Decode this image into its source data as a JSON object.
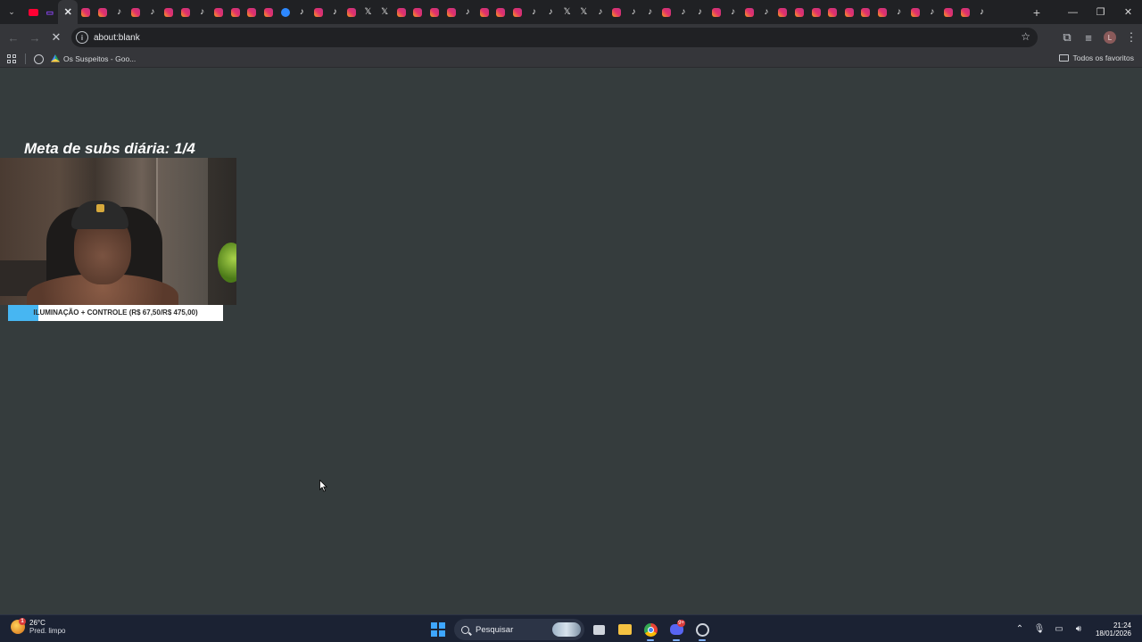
{
  "browser": {
    "tabs": [
      {
        "icon": "youtube-icon",
        "kind": "youtube",
        "glyph": ""
      },
      {
        "icon": "twitch-icon",
        "kind": "twitch",
        "glyph": "▭"
      },
      {
        "icon": "close-tab-icon",
        "kind": "close",
        "glyph": "✕",
        "active": true
      },
      {
        "icon": "instagram-icon",
        "kind": "instagram",
        "glyph": ""
      },
      {
        "icon": "instagram-icon",
        "kind": "instagram",
        "glyph": ""
      },
      {
        "icon": "tiktok-icon",
        "kind": "tiktok",
        "glyph": "♪"
      },
      {
        "icon": "instagram-icon",
        "kind": "instagram",
        "glyph": ""
      },
      {
        "icon": "tiktok-icon",
        "kind": "tiktok",
        "glyph": "♪"
      },
      {
        "icon": "instagram-icon",
        "kind": "instagram",
        "glyph": ""
      },
      {
        "icon": "instagram-icon",
        "kind": "instagram",
        "glyph": ""
      },
      {
        "icon": "tiktok-icon",
        "kind": "tiktok",
        "glyph": "♪"
      },
      {
        "icon": "instagram-icon",
        "kind": "instagram",
        "glyph": ""
      },
      {
        "icon": "instagram-icon",
        "kind": "instagram",
        "glyph": ""
      },
      {
        "icon": "instagram-icon",
        "kind": "instagram",
        "glyph": ""
      },
      {
        "icon": "instagram-icon",
        "kind": "instagram",
        "glyph": ""
      },
      {
        "icon": "messenger-icon",
        "kind": "messenger",
        "glyph": ""
      },
      {
        "icon": "tiktok-icon",
        "kind": "tiktok",
        "glyph": "♪"
      },
      {
        "icon": "instagram-icon",
        "kind": "instagram",
        "glyph": ""
      },
      {
        "icon": "tiktok-icon",
        "kind": "tiktok",
        "glyph": "♪"
      },
      {
        "icon": "instagram-icon",
        "kind": "instagram",
        "glyph": ""
      },
      {
        "icon": "x-icon",
        "kind": "x",
        "glyph": "𝕏"
      },
      {
        "icon": "x-icon",
        "kind": "x",
        "glyph": "𝕏"
      },
      {
        "icon": "instagram-icon",
        "kind": "instagram",
        "glyph": ""
      },
      {
        "icon": "instagram-icon",
        "kind": "instagram",
        "glyph": ""
      },
      {
        "icon": "instagram-icon",
        "kind": "instagram",
        "glyph": ""
      },
      {
        "icon": "instagram-icon",
        "kind": "instagram",
        "glyph": ""
      },
      {
        "icon": "tiktok-icon",
        "kind": "tiktok",
        "glyph": "♪"
      },
      {
        "icon": "instagram-icon",
        "kind": "instagram",
        "glyph": ""
      },
      {
        "icon": "instagram-icon",
        "kind": "instagram",
        "glyph": ""
      },
      {
        "icon": "instagram-icon",
        "kind": "instagram",
        "glyph": ""
      },
      {
        "icon": "tiktok-icon",
        "kind": "tiktok",
        "glyph": "♪"
      },
      {
        "icon": "tiktok-icon",
        "kind": "tiktok",
        "glyph": "♪"
      },
      {
        "icon": "x-icon",
        "kind": "x",
        "glyph": "𝕏"
      },
      {
        "icon": "x-icon",
        "kind": "x",
        "glyph": "𝕏"
      },
      {
        "icon": "tiktok-icon",
        "kind": "tiktok",
        "glyph": "♪"
      },
      {
        "icon": "instagram-icon",
        "kind": "instagram",
        "glyph": ""
      },
      {
        "icon": "tiktok-icon",
        "kind": "tiktok",
        "glyph": "♪"
      },
      {
        "icon": "tiktok-icon",
        "kind": "tiktok",
        "glyph": "♪"
      },
      {
        "icon": "instagram-icon",
        "kind": "instagram",
        "glyph": ""
      },
      {
        "icon": "tiktok-icon",
        "kind": "tiktok",
        "glyph": "♪"
      },
      {
        "icon": "tiktok-icon",
        "kind": "tiktok",
        "glyph": "♪"
      },
      {
        "icon": "instagram-icon",
        "kind": "instagram",
        "glyph": ""
      },
      {
        "icon": "tiktok-icon",
        "kind": "tiktok",
        "glyph": "♪"
      },
      {
        "icon": "instagram-icon",
        "kind": "instagram",
        "glyph": ""
      },
      {
        "icon": "tiktok-icon",
        "kind": "tiktok",
        "glyph": "♪"
      },
      {
        "icon": "instagram-icon",
        "kind": "instagram",
        "glyph": ""
      },
      {
        "icon": "instagram-icon",
        "kind": "instagram",
        "glyph": ""
      },
      {
        "icon": "instagram-icon",
        "kind": "instagram",
        "glyph": ""
      },
      {
        "icon": "instagram-icon",
        "kind": "instagram",
        "glyph": ""
      },
      {
        "icon": "instagram-icon",
        "kind": "instagram",
        "glyph": ""
      },
      {
        "icon": "instagram-icon",
        "kind": "instagram",
        "glyph": ""
      },
      {
        "icon": "instagram-icon",
        "kind": "instagram",
        "glyph": ""
      },
      {
        "icon": "tiktok-icon",
        "kind": "tiktok",
        "glyph": "♪"
      },
      {
        "icon": "instagram-icon",
        "kind": "instagram",
        "glyph": ""
      },
      {
        "icon": "tiktok-icon",
        "kind": "tiktok",
        "glyph": "♪"
      },
      {
        "icon": "instagram-icon",
        "kind": "instagram",
        "glyph": ""
      },
      {
        "icon": "instagram-icon",
        "kind": "instagram",
        "glyph": ""
      },
      {
        "icon": "tiktok-icon",
        "kind": "tiktok",
        "glyph": "♪"
      }
    ],
    "address": "about:blank",
    "bookmarks": [
      {
        "label": "Os Suspeitos - Goo..."
      }
    ],
    "all_bookmarks_label": "Todos os favoritos",
    "profile_initial": "L"
  },
  "page": {
    "goal_text": "Meta de subs diária: 1/4",
    "progress": {
      "label": "ILUMINAÇÃO + CONTROLE (R$ 67,50/R$ 475,00)",
      "fraction": 0.142
    }
  },
  "taskbar": {
    "weather": {
      "badge": "1",
      "temp": "26°C",
      "desc": "Pred. limpo"
    },
    "search_label": "Pesquisar",
    "discord_badge": "9+",
    "time": "21:24",
    "date": "18/01/2026"
  },
  "colors": {
    "page_bg": "#353c3d",
    "progress_fill": "#47b6f2",
    "taskbar_bg": "#1b2233"
  }
}
